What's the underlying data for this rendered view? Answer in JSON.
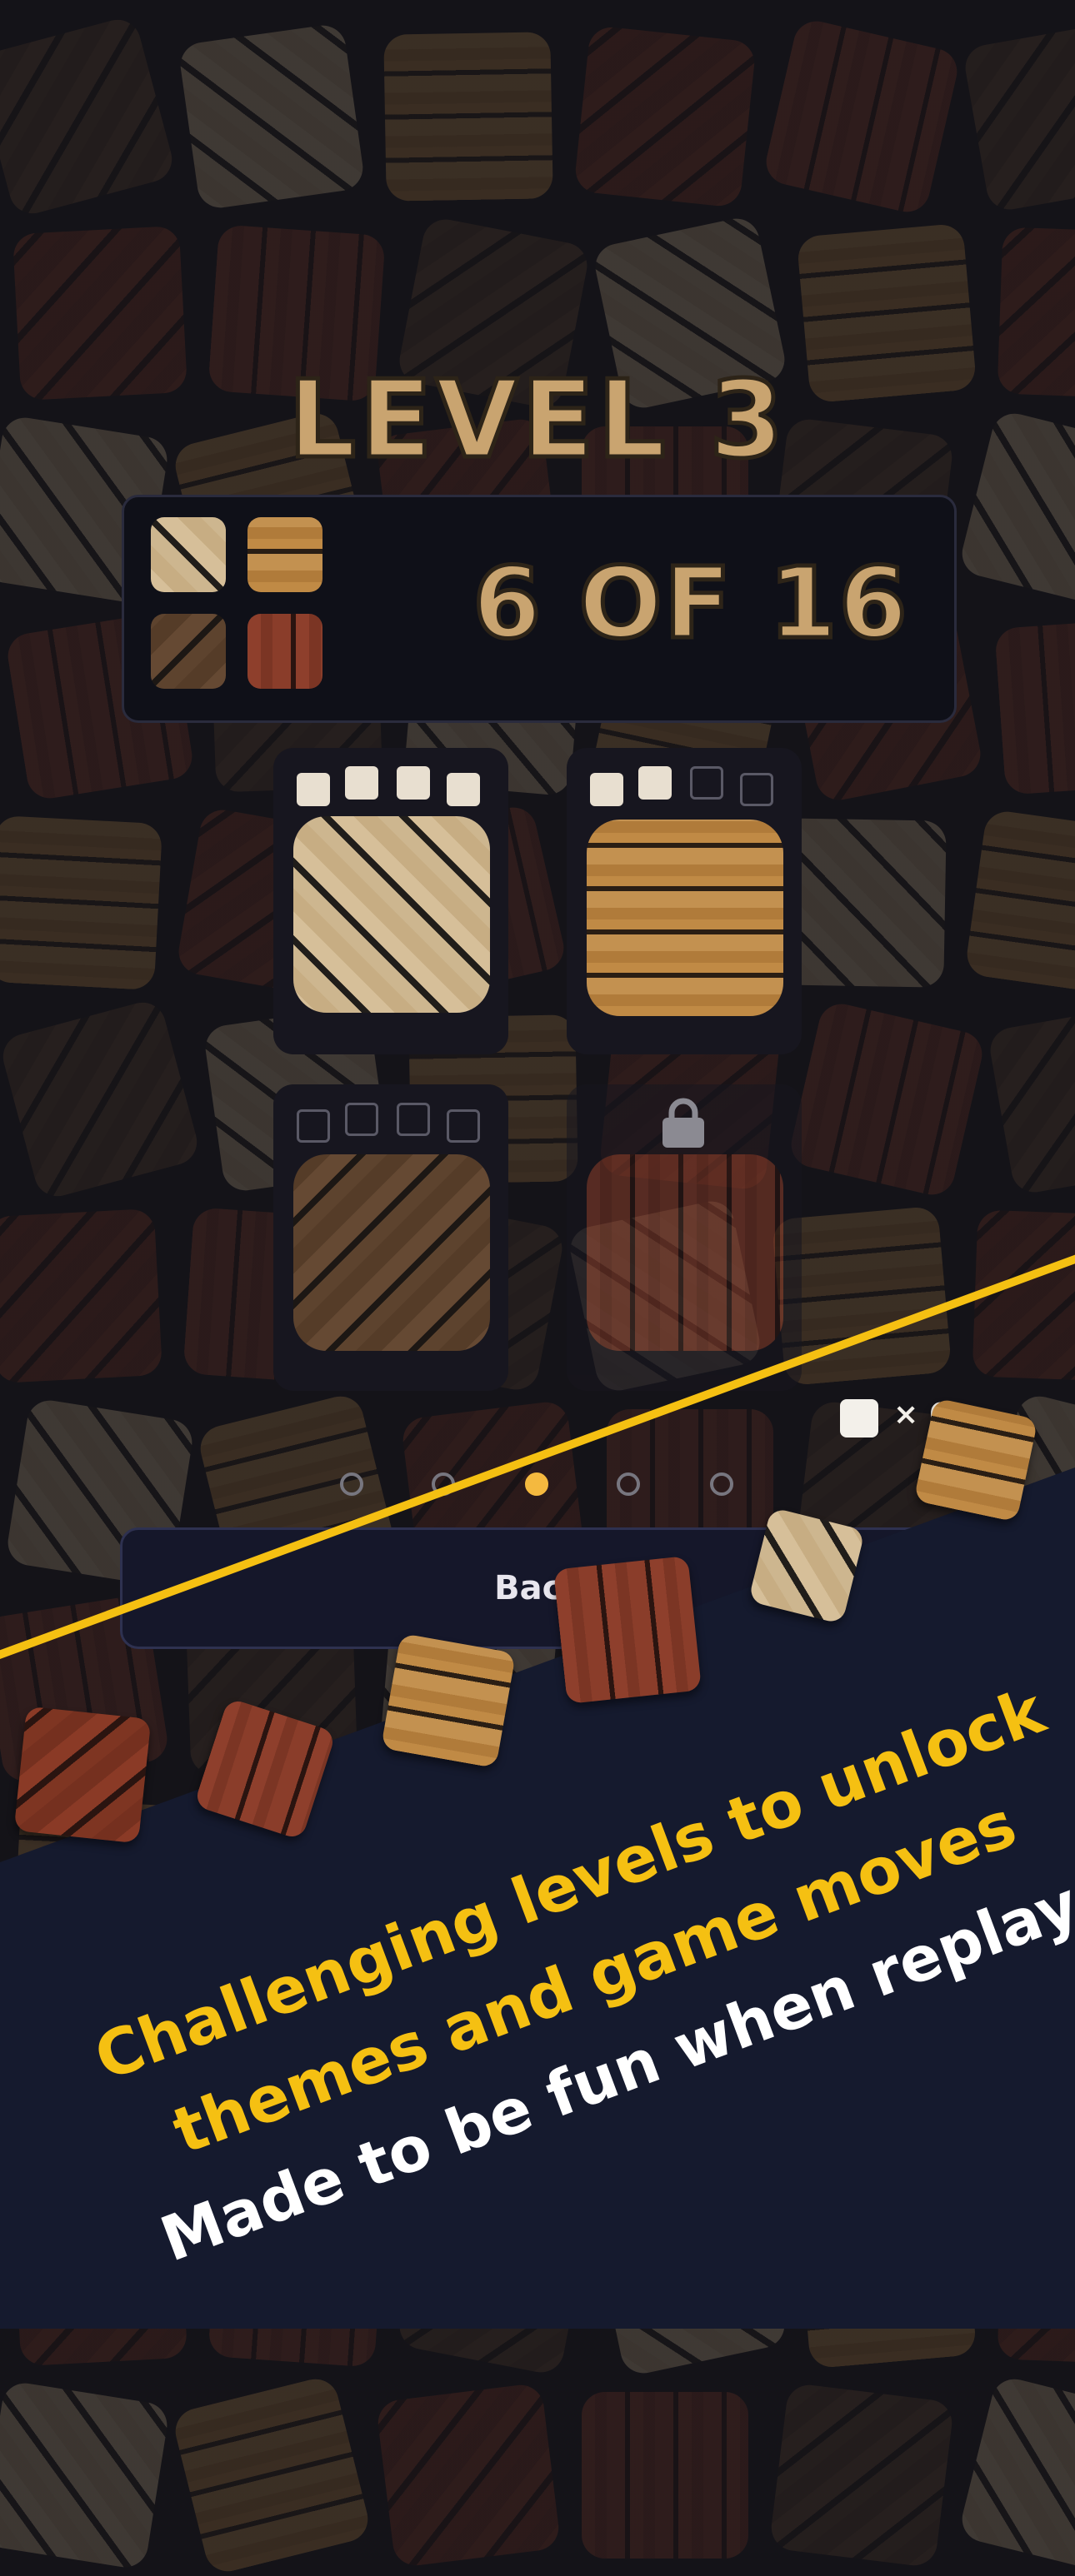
{
  "level": {
    "title": "LEVEL 3"
  },
  "progress": {
    "text": "6 OF 16"
  },
  "cards": [
    {
      "name": "theme-light-diagonal",
      "stars_filled": 4,
      "stars_total": 4,
      "locked": false
    },
    {
      "name": "theme-horizontal-plank",
      "stars_filled": 2,
      "stars_total": 4,
      "locked": false
    },
    {
      "name": "theme-dark-diagonal",
      "stars_filled": 0,
      "stars_total": 4,
      "locked": false
    },
    {
      "name": "theme-red-vertical",
      "stars_filled": 0,
      "stars_total": 4,
      "locked": true,
      "icon": "lock-icon"
    }
  ],
  "coins": {
    "label": "× 6"
  },
  "pager": {
    "pages": 5,
    "active": 3
  },
  "back_button": {
    "label": "Back"
  },
  "promo": {
    "line1": "Challenging levels to unlock",
    "line2": "themes and game moves",
    "line3": "Made to be fun when replayed"
  },
  "colors": {
    "accent": "#f5c012",
    "background": "#141318",
    "promo_band": "#151a2e",
    "wood_gold": "#c9a470"
  }
}
